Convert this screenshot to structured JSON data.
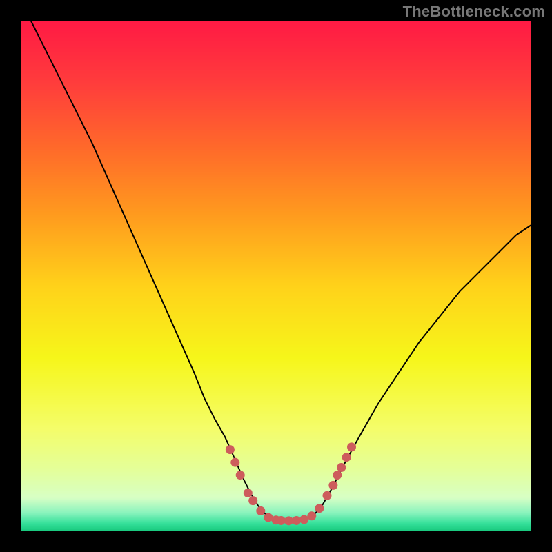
{
  "watermark": "TheBottleneck.com",
  "colors": {
    "gradient_stops": [
      {
        "t": 0.0,
        "hex": "#ff1a44"
      },
      {
        "t": 0.12,
        "hex": "#ff3c3c"
      },
      {
        "t": 0.25,
        "hex": "#ff6a2a"
      },
      {
        "t": 0.38,
        "hex": "#ff9b1e"
      },
      {
        "t": 0.52,
        "hex": "#ffd21a"
      },
      {
        "t": 0.66,
        "hex": "#f6f61a"
      },
      {
        "t": 0.8,
        "hex": "#f4fd6a"
      },
      {
        "t": 0.88,
        "hex": "#e4ff9a"
      },
      {
        "t": 0.935,
        "hex": "#d7ffc5"
      },
      {
        "t": 0.965,
        "hex": "#88f3bd"
      },
      {
        "t": 0.985,
        "hex": "#37e19b"
      },
      {
        "t": 1.0,
        "hex": "#18c97e"
      }
    ],
    "dot": "#cd5c5c",
    "curve": "#000000"
  },
  "chart_data": {
    "type": "line",
    "title": "",
    "xlabel": "",
    "ylabel": "",
    "xlim": [
      0,
      100
    ],
    "ylim": [
      0,
      100
    ],
    "grid": false,
    "series": [
      {
        "name": "left-curve",
        "x": [
          2,
          6,
          10,
          14,
          18,
          22,
          26,
          30,
          34,
          36,
          38,
          40,
          42,
          43.5,
          45,
          46.5,
          48,
          49
        ],
        "y": [
          100,
          92,
          84,
          76,
          67,
          58,
          49,
          40,
          31,
          26,
          22,
          18.5,
          14,
          10.5,
          7.5,
          5.0,
          3.3,
          2.5
        ]
      },
      {
        "name": "valley-floor",
        "x": [
          49,
          50,
          51,
          52,
          53,
          54,
          55,
          56
        ],
        "y": [
          2.5,
          2.2,
          2.1,
          2.05,
          2.05,
          2.1,
          2.2,
          2.5
        ]
      },
      {
        "name": "right-curve",
        "x": [
          56,
          57.5,
          59,
          61,
          63,
          66,
          70,
          74,
          78,
          82,
          86,
          90,
          94,
          97,
          100
        ],
        "y": [
          2.5,
          3.3,
          5.0,
          8.5,
          12.5,
          18,
          25,
          31,
          37,
          42,
          47,
          51,
          55,
          58,
          60
        ]
      }
    ],
    "scatter": {
      "name": "dots",
      "points": [
        {
          "x": 41.0,
          "y": 16.0
        },
        {
          "x": 42.0,
          "y": 13.5
        },
        {
          "x": 43.0,
          "y": 11.0
        },
        {
          "x": 44.5,
          "y": 7.5
        },
        {
          "x": 45.5,
          "y": 6.0
        },
        {
          "x": 47.0,
          "y": 4.0
        },
        {
          "x": 48.5,
          "y": 2.7
        },
        {
          "x": 50.0,
          "y": 2.2
        },
        {
          "x": 51.0,
          "y": 2.1
        },
        {
          "x": 52.5,
          "y": 2.05
        },
        {
          "x": 54.0,
          "y": 2.1
        },
        {
          "x": 55.5,
          "y": 2.3
        },
        {
          "x": 57.0,
          "y": 3.0
        },
        {
          "x": 58.5,
          "y": 4.5
        },
        {
          "x": 60.0,
          "y": 7.0
        },
        {
          "x": 61.2,
          "y": 9.0
        },
        {
          "x": 62.0,
          "y": 11.0
        },
        {
          "x": 62.8,
          "y": 12.5
        },
        {
          "x": 63.8,
          "y": 14.5
        },
        {
          "x": 64.8,
          "y": 16.5
        }
      ]
    }
  }
}
